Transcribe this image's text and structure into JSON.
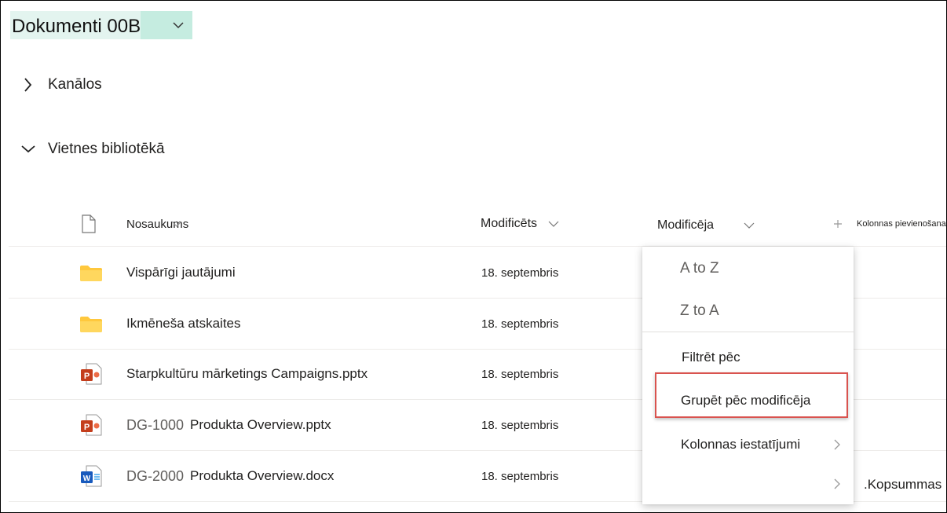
{
  "library": {
    "title": "Dokumenti 00B"
  },
  "sections": [
    {
      "label": "Kanālos",
      "expanded": false
    },
    {
      "label": "Vietnes bibliotēkā",
      "expanded": true
    }
  ],
  "columns": {
    "name": "Nosaukums",
    "modified": "Modificēts",
    "modified_by": "Modificēja",
    "add_column": "Kolonnas pievienošana"
  },
  "rows": [
    {
      "type": "folder",
      "prefix": "",
      "name": "Vispārīgi jautājumi",
      "modified": "18. septembris"
    },
    {
      "type": "folder",
      "prefix": "",
      "name": "Ikmēneša atskaites",
      "modified": "18. septembris"
    },
    {
      "type": "pptx",
      "prefix": "",
      "name": "Starpkultūru mārketings Campaigns.pptx",
      "modified": "18. septembris"
    },
    {
      "type": "pptx",
      "prefix": "DG-1000",
      "name": "Produkta Overview.pptx",
      "modified": "18. septembris"
    },
    {
      "type": "docx",
      "prefix": "DG-2000",
      "name": "Produkta Overview.docx",
      "modified": "18. septembris"
    }
  ],
  "column_menu": {
    "sort_asc": "A to Z",
    "sort_desc": "Z to A",
    "filter": "Filtrēt pēc",
    "group": "Grupēt pēc modificēja",
    "settings": "Kolonnas iestatījumi",
    "totals": ".Kopsummas"
  },
  "colors": {
    "title_highlight": "#c5ece0",
    "folder": "#ffc83d",
    "powerpoint": "#c43e1c",
    "word": "#185abd",
    "highlight_border": "#d9534f"
  }
}
